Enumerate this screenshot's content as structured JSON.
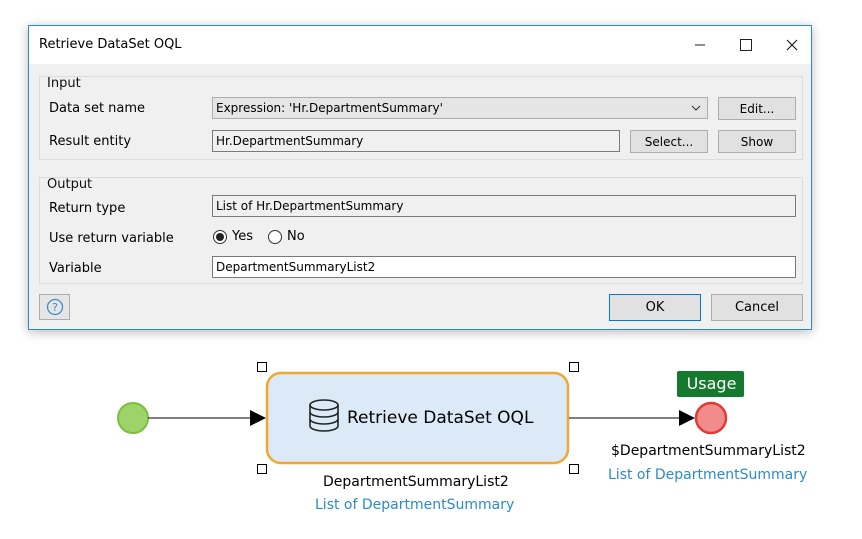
{
  "dialog": {
    "title": "Retrieve DataSet OQL",
    "input_group": {
      "title": "Input",
      "dataset_label": "Data set name",
      "dataset_value": "Expression: 'Hr.DepartmentSummary'",
      "edit_button": "Edit...",
      "entity_label": "Result entity",
      "entity_value": "Hr.DepartmentSummary",
      "select_button": "Select...",
      "show_button": "Show"
    },
    "output_group": {
      "title": "Output",
      "return_type_label": "Return type",
      "return_type_value": "List of Hr.DepartmentSummary",
      "use_return_label": "Use return variable",
      "yes_label": "Yes",
      "no_label": "No",
      "selected": "Yes",
      "variable_label": "Variable",
      "variable_value": "DepartmentSummaryList2"
    },
    "ok_button": "OK",
    "cancel_button": "Cancel"
  },
  "flow": {
    "activity_label": "Retrieve DataSet OQL",
    "activity_output_name": "DepartmentSummaryList2",
    "activity_output_type": "List of DepartmentSummary",
    "usage_badge": "Usage",
    "end_output_name": "$DepartmentSummaryList2",
    "end_output_type": "List of DepartmentSummary",
    "colors": {
      "start_event": "#9ed36a",
      "end_event": "#f28b8b",
      "activity_fill": "#dbeaf6",
      "activity_border": "#f0a830",
      "usage_badge": "#157a2e",
      "link_text": "#2a8cc8"
    }
  }
}
